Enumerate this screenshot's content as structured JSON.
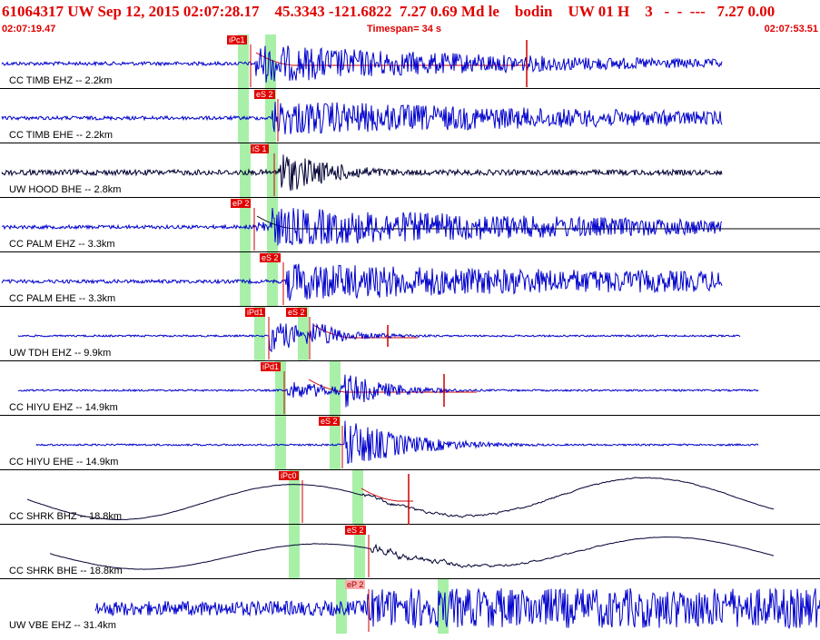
{
  "header": {
    "title": "61064317 UW Sep 12, 2015 02:07:28.17    45.3343 -121.6822  7.27 0.69 Md le    bodin    UW 01 H    3   -  -  ---   7.27 0.00",
    "start_time": "02:07:19.47",
    "end_time": "02:07:53.51",
    "timespan": "Timespan=  34 s"
  },
  "colors": {
    "title": "#e00000",
    "trace_blue": "#0000cc",
    "trace_black": "#000033",
    "pick_box": "#e00000",
    "pick_box_alt": "#ffaaaa",
    "pick_window": "#a8f0a8",
    "separator": "#000000"
  },
  "traces": [
    {
      "label": "CC TIMB EHZ -- 2.2km",
      "color": "blue"
    },
    {
      "label": "CC TIMB EHE -- 2.2km",
      "color": "blue"
    },
    {
      "label": "UW HOOD BHE -- 2.8km",
      "color": "black"
    },
    {
      "label": "CC PALM EHZ -- 3.3km",
      "color": "blue"
    },
    {
      "label": "CC PALM EHE -- 3.3km",
      "color": "blue"
    },
    {
      "label": "UW TDH EHZ -- 9.9km",
      "color": "blue"
    },
    {
      "label": "CC HIYU EHZ -- 14.9km",
      "color": "blue"
    },
    {
      "label": "CC HIYU EHE -- 14.9km",
      "color": "blue"
    },
    {
      "label": "CC SHRK BHZ -- 18.8km",
      "color": "black"
    },
    {
      "label": "CC SHRK BHE -- 18.8km",
      "color": "black"
    },
    {
      "label": "UW VBE EHZ -- 31.4km",
      "color": "blue"
    }
  ],
  "picks": [
    {
      "trace": 0,
      "label": "iPc1"
    },
    {
      "trace": 1,
      "label": "eS 2"
    },
    {
      "trace": 2,
      "label": "iS 1"
    },
    {
      "trace": 3,
      "label": "eP 2"
    },
    {
      "trace": 4,
      "label": "eS 2"
    },
    {
      "trace": 5,
      "label": "iPd1"
    },
    {
      "trace": 5,
      "label": "eS 2"
    },
    {
      "trace": 6,
      "label": "iPd1"
    },
    {
      "trace": 7,
      "label": "eS 2"
    },
    {
      "trace": 8,
      "label": "iPc0"
    },
    {
      "trace": 9,
      "label": "eS 2"
    },
    {
      "trace": 10,
      "label": "eP 2"
    }
  ]
}
